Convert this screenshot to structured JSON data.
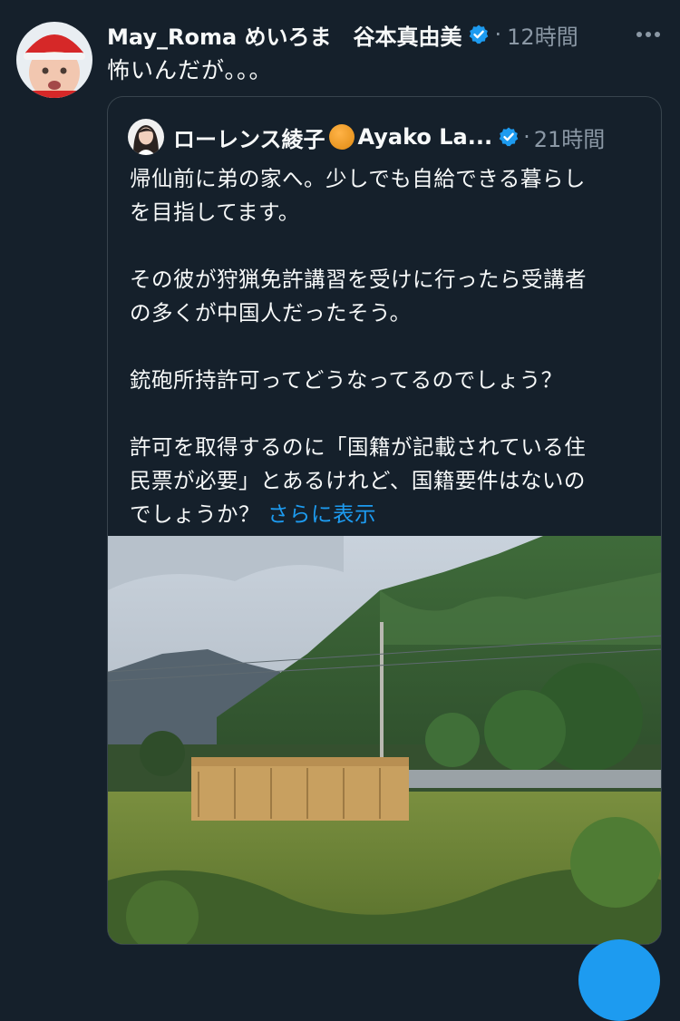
{
  "tweet": {
    "display_name": "May_Roma めいろま　谷本真由美",
    "separator": "·",
    "time": "12時間",
    "text": "怖いんだが。。。",
    "avatar_icon": "baby-avatar"
  },
  "quote": {
    "display_name": "ローレンス綾子",
    "display_name_suffix": "Ayako La...",
    "separator": "·",
    "time": "21時間",
    "paragraphs": [
      "帰仙前に弟の家へ。少しでも自給できる暮らし\nを目指してます。",
      "その彼が狩猟免許講習を受けに行ったら受講者\nの多くが中国人だったそう。",
      "銃砲所持許可ってどうなってるのでしょう？",
      "許可を取得するのに「国籍が記載されている住\n民票が必要」とあるけれど、国籍要件はないの\nでしょうか？"
    ],
    "show_more": "さらに表示",
    "image_icon": "landscape-photo"
  },
  "colors": {
    "background": "#15202b",
    "text": "#f7f9f9",
    "muted": "#8b98a5",
    "accent": "#1d9bf0",
    "border": "#38444d"
  },
  "icons": {
    "verified": "verified-badge-icon",
    "more": "more-options-icon",
    "emoji": "orange-circle-emoji"
  }
}
